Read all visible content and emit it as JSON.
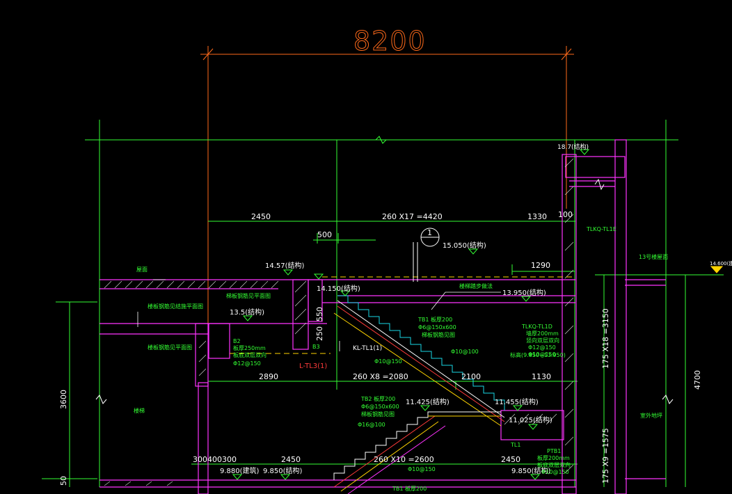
{
  "drawing": {
    "colors": {
      "background": "#000000",
      "dimension": "#33ff33",
      "text": "#ffffff",
      "wall": "#ff33ff",
      "overall_dim": "#ff6a1a",
      "stair": "#ffffff",
      "rebar": "#ff3b3b",
      "tread": "#19d7e6",
      "hidden": "#ffd400"
    },
    "overall_dim": "8200",
    "dims_top": {
      "d1": "2450",
      "d2": "260 X17 =4420",
      "d3": "1330",
      "d4": "100",
      "d5": "500",
      "d6": "1290"
    },
    "dims_mid": {
      "d1": "2890",
      "d2": "260 X8 =2080",
      "d3": "2100",
      "d4": "1130"
    },
    "dims_low": {
      "d1": "300400300",
      "d2": "2450",
      "d3": "260 X10 =2600",
      "d4": "2450"
    },
    "dims_vertical": {
      "v1": "3600",
      "v2": "175 X18 =3150",
      "v3": "4700",
      "v4": "175 X9 =1575",
      "v5": "50",
      "v6": "550",
      "v7": "250"
    },
    "elevations": {
      "e1": "18.7(结构)",
      "e2": "15.050(结构)",
      "e3": "14.57(结构)",
      "e4": "14.150(结构)",
      "e5": "13.950(结构)",
      "e6": "13.5(结构)",
      "e7": "11.425(结构)",
      "e8": "11.455(结构)",
      "e9": "11.025(结构)",
      "e10": "9.880(建筑)",
      "e11": "9.850(结构)",
      "e12": "9.850(结构)",
      "e13": "14.600(建"
    },
    "labels": {
      "axis_num": "1",
      "tl3": "L-TL3(1)",
      "kl": "KL-TL1(1)",
      "tb1": "TB1 板厚200",
      "tb1_r1": "Φ6@150x600",
      "tb1_r2": "梯板钢筋见图",
      "rebar1": "Φ10@150",
      "rebar2": "Φ10@100",
      "tb2": "TB2 板厚200",
      "tb2_r1": "Φ6@150x600",
      "tb2_r2": "梯板钢筋见图",
      "tb2_r3": "Φ16@100",
      "tb2_r4": "Φ10@150",
      "tb1_low": "TB1 板厚200",
      "b2": "B2",
      "b2_r1": "板厚250mm",
      "b2_r2": "板底双层双向",
      "b2_r3": "Φ12@150",
      "b3": "B3",
      "tl1": "TL1",
      "ptb1": "PTB1",
      "ptb1_r1": "板厚200mm",
      "ptb1_r2": "板底双层双向",
      "ptb1_r3": "Φ10@150",
      "tlkq_top": "TLKQ-TL1E",
      "tlkq": "TLKQ-TL1D",
      "tlkq_r1": "墙厚200mm",
      "tlkq_r2": "竖向双层双向",
      "tlkq_r3": "Φ12@150",
      "tlkq_r4": "Φ10@150",
      "tlkq_r5": "标高(9.850~13.950)",
      "note_roof": "屋面",
      "note_slab1": "楼板钢筋见结施平面图",
      "note_slab2": "楼板钢筋见平面图",
      "note_left": "梯板钢筋见平面图",
      "note_tread": "楼梯踏步做法",
      "note_room": "楼梯",
      "note_right1": "13号楼屋面",
      "note_right2": "室外地坪"
    }
  }
}
